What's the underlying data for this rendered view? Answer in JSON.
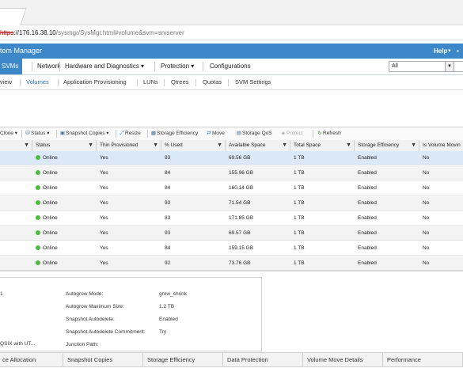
{
  "browser": {
    "url_scheme": "https",
    "url_host": "://176.16.38.10",
    "url_rest": "/sysmgr/SysMgr.html#volume&svm=srvserver"
  },
  "header": {
    "title": "tem Manager",
    "help_label": "Help",
    "help_caret": "▾"
  },
  "main_nav": {
    "items": [
      "SVMs",
      "Network",
      "Hardware and Diagnostics ▾",
      "Protection ▾",
      "Configurations"
    ],
    "filter_value": "All"
  },
  "sub_nav": {
    "items": [
      "view",
      "Volumes",
      "Application Provisioning",
      "LUNs",
      "Qtrees",
      "Quotas",
      "SVM Settings"
    ],
    "active": "Volumes"
  },
  "toolbar": {
    "items": [
      "Clone ▾",
      "Status ▾",
      "Snapshot Copies ▾",
      "Resize",
      "Storage Efficiency",
      "Move",
      "Storage QoS",
      "Protect",
      "Refresh"
    ]
  },
  "grid": {
    "columns": [
      "Status",
      "Thin Provisioned",
      "% Used",
      "Available Space",
      "Total Space",
      "Storage Efficiency",
      "Is Volume Movin"
    ],
    "rows": [
      [
        "Online",
        "Yes",
        "93",
        "69.56 GB",
        "1 TB",
        "Enabled",
        "No"
      ],
      [
        "Online",
        "Yes",
        "84",
        "155.96 GB",
        "1 TB",
        "Enabled",
        "No"
      ],
      [
        "Online",
        "Yes",
        "84",
        "160.14 GB",
        "1 TB",
        "Enabled",
        "No"
      ],
      [
        "Online",
        "Yes",
        "93",
        "71.54 GB",
        "1 TB",
        "Enabled",
        "No"
      ],
      [
        "Online",
        "Yes",
        "83",
        "171.85 GB",
        "1 TB",
        "Enabled",
        "No"
      ],
      [
        "Online",
        "Yes",
        "93",
        "69.57 GB",
        "1 TB",
        "Enabled",
        "No"
      ],
      [
        "Online",
        "Yes",
        "84",
        "159.15 GB",
        "1 TB",
        "Enabled",
        "No"
      ],
      [
        "Online",
        "Yes",
        "92",
        "73.76 GB",
        "1 TB",
        "Enabled",
        "No"
      ]
    ],
    "status_color": "#4cbb3f",
    "selected_row": 0
  },
  "details": {
    "left_a": "1",
    "left_b": "QSIX with UT...",
    "fields": [
      {
        "label": "Autogrow Mode:",
        "value": "grow_shrink"
      },
      {
        "label": "Autogrow Maximum Size:",
        "value": "1.2 TB"
      },
      {
        "label": "Snapshot Autodelete:",
        "value": "Enabled"
      },
      {
        "label": "Snapshot Autodelete Commitment:",
        "value": "Try"
      },
      {
        "label": "Junction Path:",
        "value": ""
      }
    ]
  },
  "bottom_tabs": [
    "ce Allocation",
    "Snapshot Copies",
    "Storage Efficiency",
    "Data Protection",
    "Volume Move Details",
    "Performance"
  ],
  "colors": {
    "accent": "#3c87c7",
    "link": "#1f70b8"
  }
}
